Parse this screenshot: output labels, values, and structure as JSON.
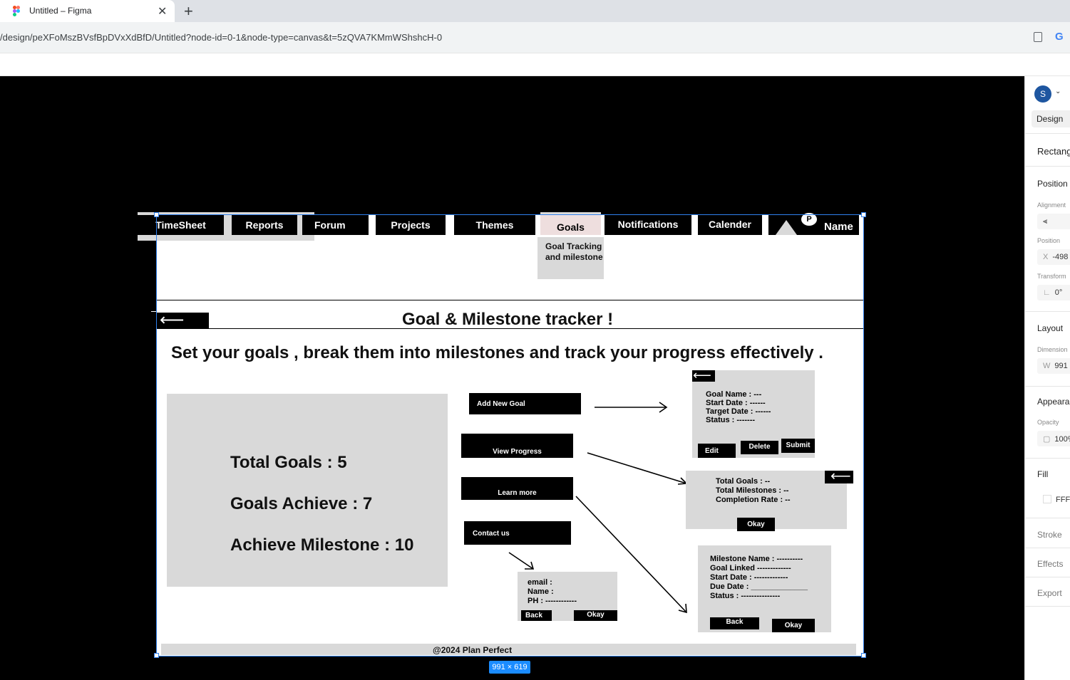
{
  "browser": {
    "tab_title": "Untitled – Figma",
    "tab_close": "✕",
    "new_tab": "+",
    "url": "/design/peXFoMszBVsfBpDVxXdBfD/Untitled?node-id=0-1&node-type=canvas&t=5zQVA7KMmWShshcH-0",
    "google_glyph": "G"
  },
  "panel": {
    "avatar": "S",
    "avatar_caret": "⌄",
    "design_tab": "Design",
    "layer_name": "Rectang",
    "position_heading": "Position",
    "alignment_label": "Alignment",
    "position_label": "Position",
    "x_label": "X",
    "x_value": "-498",
    "transform_label": "Transform",
    "rotation_value": "0°",
    "layout_heading": "Layout",
    "dimensions_label": "Dimension",
    "w_label": "W",
    "w_value": "991",
    "appearance_heading": "Appearar",
    "opacity_label": "Opacity",
    "opacity_value": "100%",
    "fill_heading": "Fill",
    "fill_value": "FFFF",
    "stroke_heading": "Stroke",
    "effects_heading": "Effects",
    "export_heading": "Export"
  },
  "selection": {
    "dimensions": "991 × 619"
  },
  "design": {
    "nav": {
      "timesheet": "TimeSheet",
      "reports": "Reports",
      "forum": "Forum",
      "projects": "Projects",
      "themes": "Themes",
      "goals": "Goals",
      "notifications": "Notifications",
      "calender": "Calender",
      "profile_initial": "P",
      "name": "Name"
    },
    "goals_dropdown": "Goal Tracking and milestone",
    "back_arrow": "⟵",
    "title": "Goal & Milestone tracker !",
    "subtitle": "Set your goals , break them into milestones and track your progress effectively .",
    "stats": {
      "total_goals": "Total Goals : 5",
      "goals_achieve": "Goals Achieve : 7",
      "achieve_milestone": "Achieve Milestone : 10"
    },
    "buttons": {
      "add_new_goal": "Add New Goal",
      "view_progress": "View Progress",
      "learn_more": "Learn more",
      "contact_us": "Contact us"
    },
    "goal_form": {
      "back_arrow": "⟵",
      "goal_name": "Goal Name : ---",
      "start_date": "Start Date : ------",
      "target_date": "Target Date : ------",
      "status": "Status : -------",
      "edit": "Edit",
      "delete": "Delete",
      "submit": "Submit"
    },
    "progress_box": {
      "back_arrow": "⟵",
      "total_goals": "Total Goals : --",
      "total_milestones": "Total Milestones : --",
      "completion_rate": "Completion Rate : --",
      "okay": "Okay"
    },
    "contact_box": {
      "email": "email :",
      "name": "Name :",
      "phone": "PH : ------------",
      "back": "Back",
      "okay": "Okay"
    },
    "milestone_box": {
      "milestone_name": "Milestone Name  : ----------",
      "goal_linked": "Goal Linked -------------",
      "start_date": "Start Date : -------------",
      "due_date": "Due Date : _____________",
      "status": "Status : ---------------",
      "back": "Back",
      "okay": "Okay"
    },
    "footer": "@2024 Plan Perfect"
  }
}
